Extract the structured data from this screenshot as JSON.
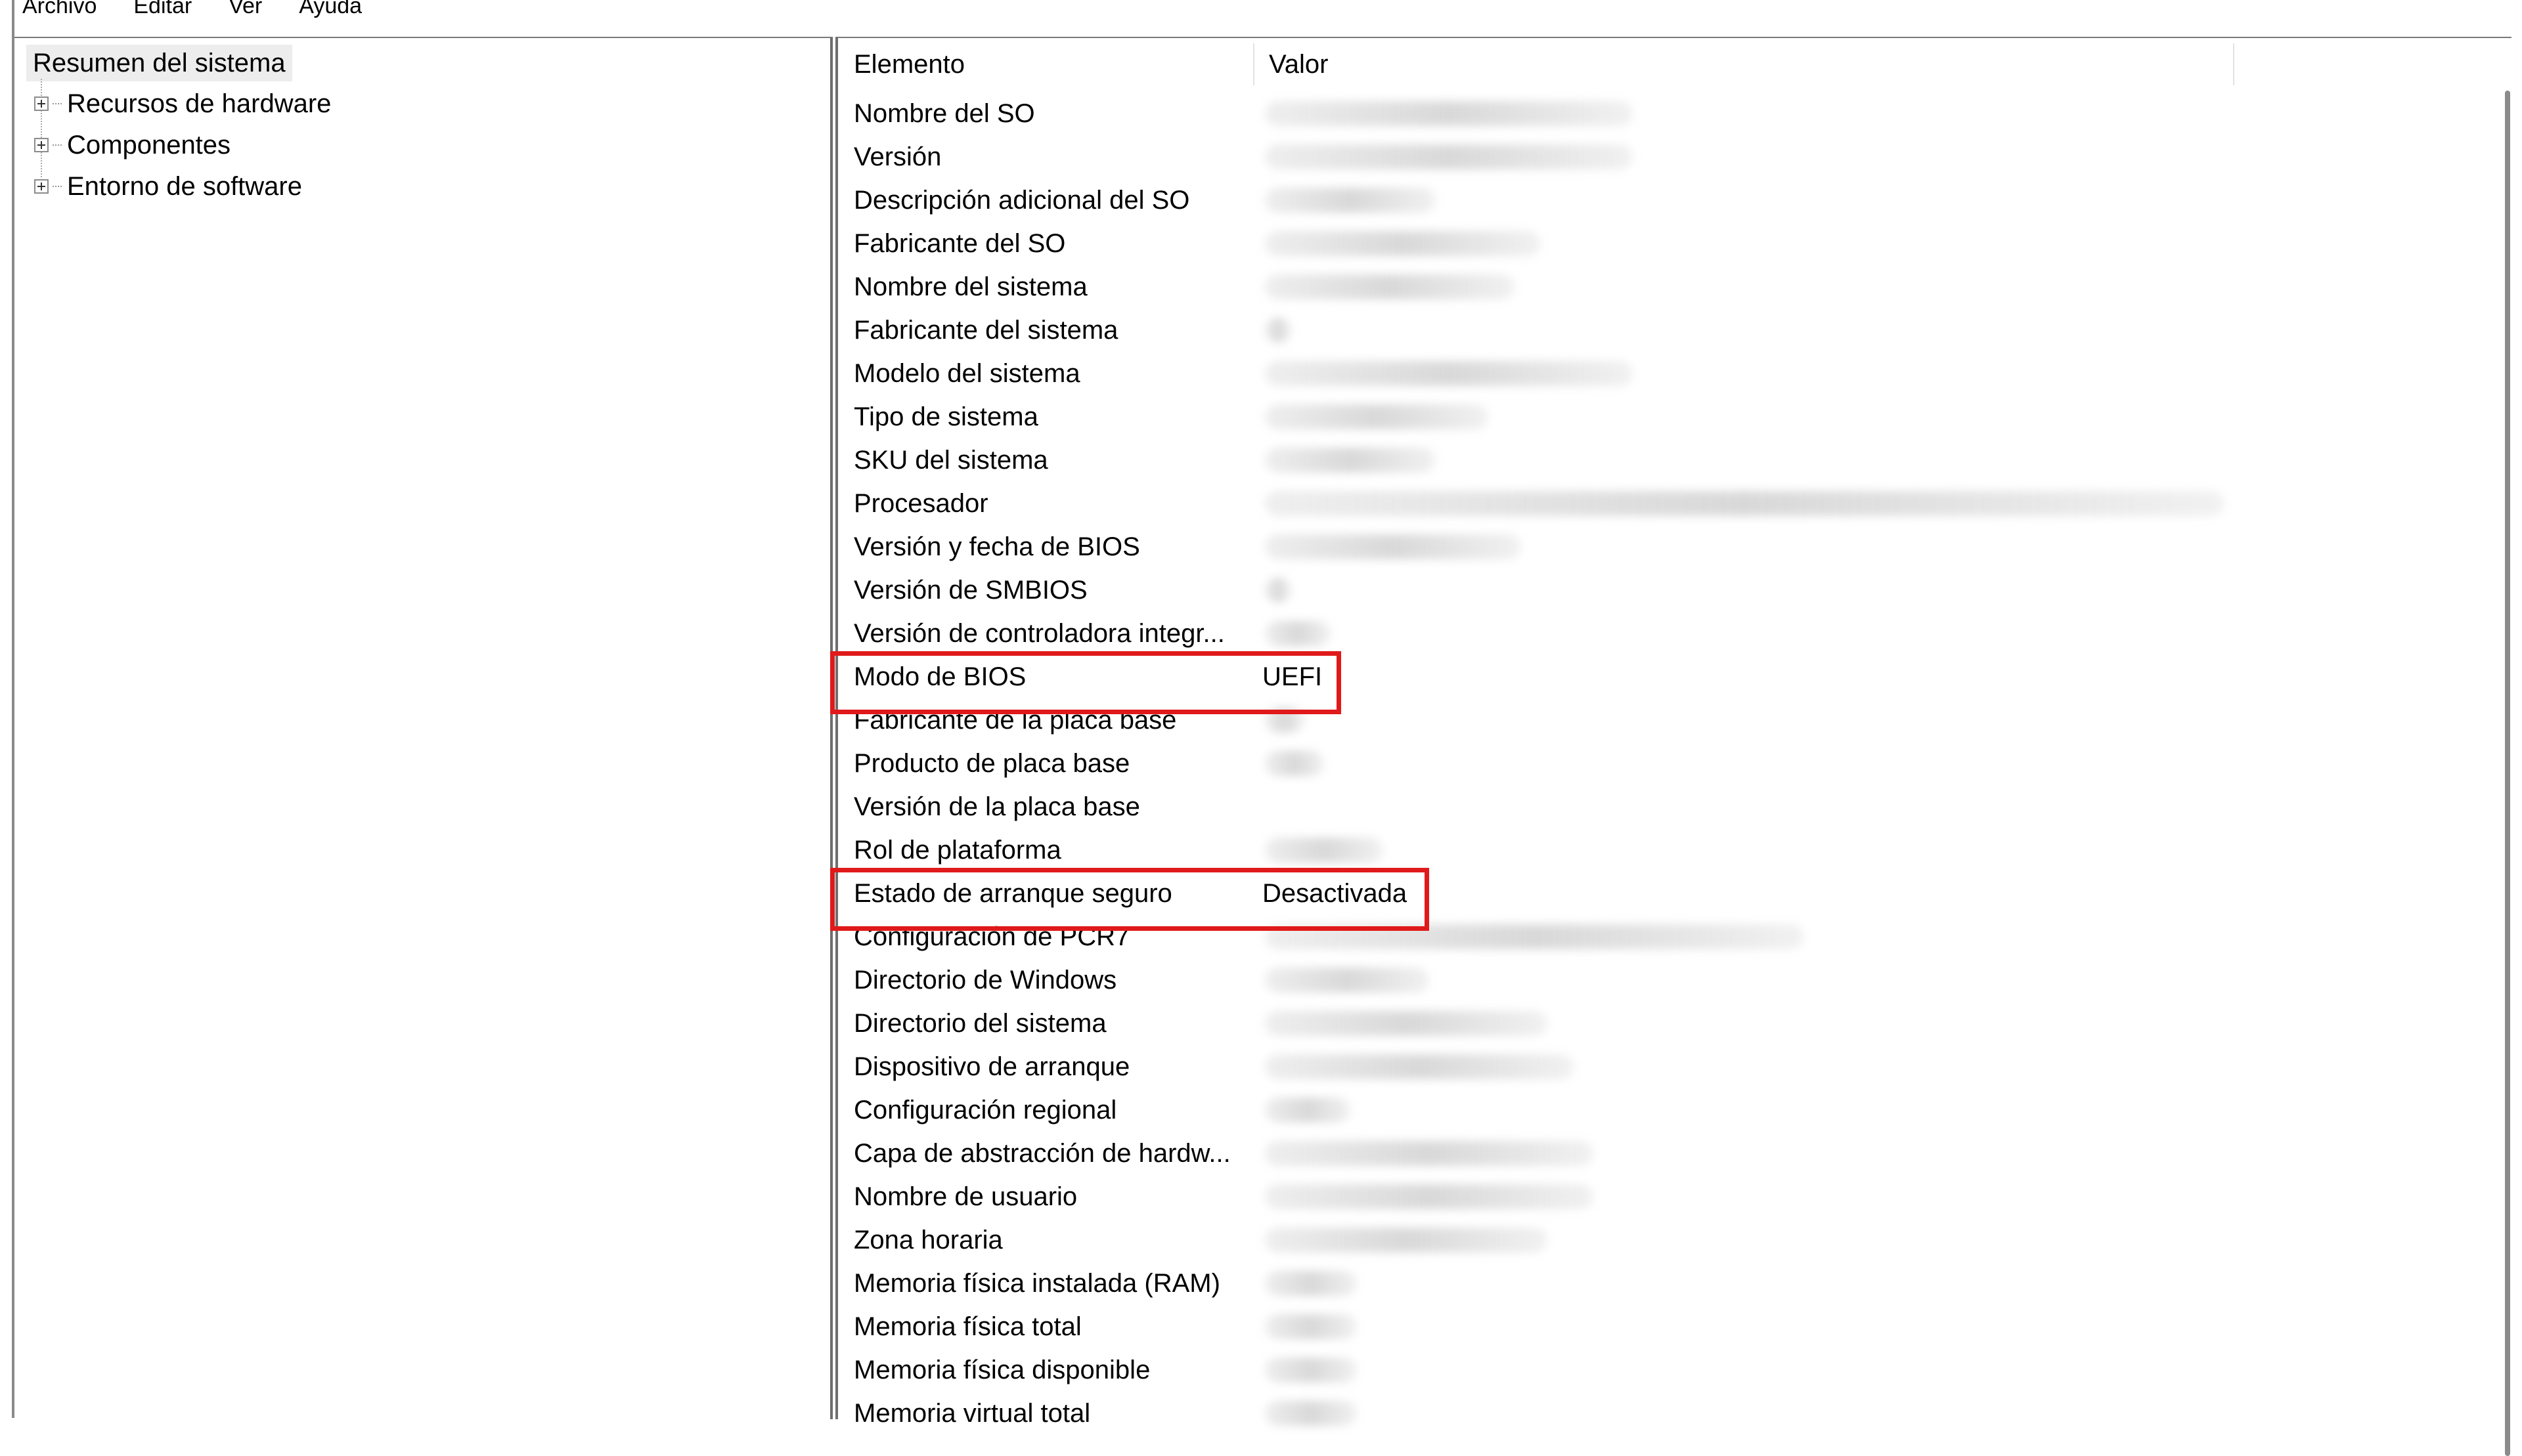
{
  "menu": [
    "Archivo",
    "Editar",
    "Ver",
    "Ayuda"
  ],
  "tree": {
    "root": "Resumen del sistema",
    "nodes": [
      "Recursos de hardware",
      "Componentes",
      "Entorno de software"
    ]
  },
  "list": {
    "columns": [
      "Elemento",
      "Valor"
    ],
    "rows": [
      {
        "element": "Nombre del SO",
        "value": ""
      },
      {
        "element": "Versión",
        "value": ""
      },
      {
        "element": "Descripción adicional del SO",
        "value": ""
      },
      {
        "element": "Fabricante del SO",
        "value": ""
      },
      {
        "element": "Nombre del sistema",
        "value": ""
      },
      {
        "element": "Fabricante del sistema",
        "value": ""
      },
      {
        "element": "Modelo del sistema",
        "value": ""
      },
      {
        "element": "Tipo de sistema",
        "value": ""
      },
      {
        "element": "SKU del sistema",
        "value": ""
      },
      {
        "element": "Procesador",
        "value": ""
      },
      {
        "element": "Versión y fecha de BIOS",
        "value": ""
      },
      {
        "element": "Versión de SMBIOS",
        "value": ""
      },
      {
        "element": "Versión de controladora integr...",
        "value": ""
      },
      {
        "element": "Modo de BIOS",
        "value": "UEFI"
      },
      {
        "element": "Fabricante de la placa base",
        "value": ""
      },
      {
        "element": "Producto de placa base",
        "value": ""
      },
      {
        "element": "Versión de la placa base",
        "value": ""
      },
      {
        "element": "Rol de plataforma",
        "value": ""
      },
      {
        "element": "Estado de arranque seguro",
        "value": "Desactivada"
      },
      {
        "element": "Configuración de PCR7",
        "value": ""
      },
      {
        "element": "Directorio de Windows",
        "value": ""
      },
      {
        "element": "Directorio del sistema",
        "value": ""
      },
      {
        "element": "Dispositivo de arranque",
        "value": ""
      },
      {
        "element": "Configuración regional",
        "value": ""
      },
      {
        "element": "Capa de abstracción de hardw...",
        "value": ""
      },
      {
        "element": "Nombre de usuario",
        "value": ""
      },
      {
        "element": "Zona horaria",
        "value": ""
      },
      {
        "element": "Memoria física instalada (RAM)",
        "value": ""
      },
      {
        "element": "Memoria física total",
        "value": ""
      },
      {
        "element": "Memoria física disponible",
        "value": ""
      },
      {
        "element": "Memoria virtual total",
        "value": ""
      }
    ]
  },
  "highlight_color": "#e01a1a"
}
